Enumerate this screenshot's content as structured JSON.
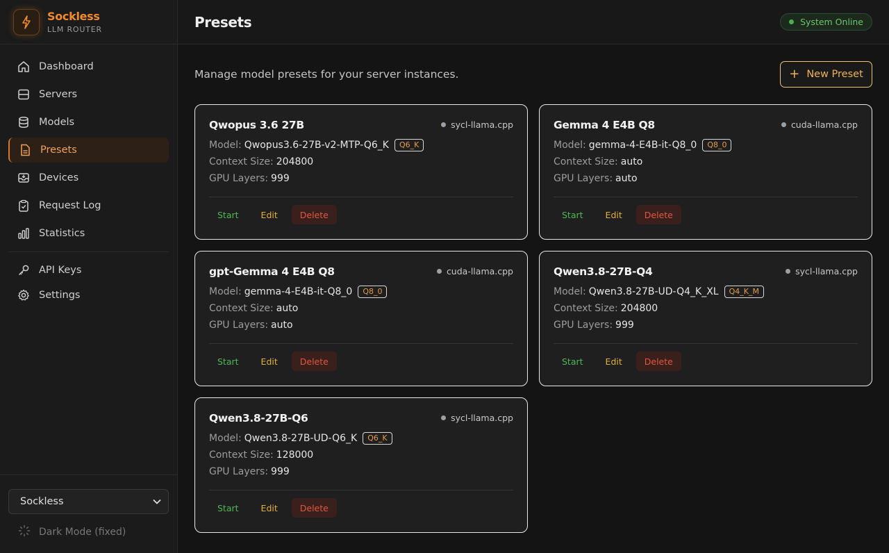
{
  "brand": {
    "name": "Sockless",
    "subtitle": "LLM ROUTER"
  },
  "nav": {
    "items": [
      {
        "label": "Dashboard",
        "icon": "home-icon"
      },
      {
        "label": "Servers",
        "icon": "server-icon"
      },
      {
        "label": "Models",
        "icon": "database-icon"
      },
      {
        "label": "Presets",
        "icon": "document-icon",
        "active": true
      },
      {
        "label": "Devices",
        "icon": "inbox-icon"
      },
      {
        "label": "Request Log",
        "icon": "clipboard-icon"
      },
      {
        "label": "Statistics",
        "icon": "bar-chart-icon"
      }
    ],
    "secondary": [
      {
        "label": "API Keys",
        "icon": "key-icon"
      },
      {
        "label": "Settings",
        "icon": "gear-icon"
      }
    ]
  },
  "workspace": {
    "selected": "Sockless"
  },
  "theme": {
    "label": "Dark Mode (fixed)"
  },
  "header": {
    "title": "Presets",
    "status": "System Online"
  },
  "main": {
    "description": "Manage model presets for your server instances.",
    "new_button": "New Preset",
    "plus_symbol": "+"
  },
  "labels": {
    "model": "Model:",
    "context": "Context Size:",
    "gpu": "GPU Layers:",
    "start": "Start",
    "edit": "Edit",
    "delete": "Delete"
  },
  "presets": [
    {
      "name": "Qwopus 3.6 27B",
      "engine": "sycl-llama.cpp",
      "model": "Qwopus3.6-27B-v2-MTP-Q6_K",
      "quant": "Q6_K",
      "context": "204800",
      "gpu": "999"
    },
    {
      "name": "Gemma 4 E4B Q8",
      "engine": "cuda-llama.cpp",
      "model": "gemma-4-E4B-it-Q8_0",
      "quant": "Q8_0",
      "context": "auto",
      "gpu": "auto"
    },
    {
      "name": "gpt-Gemma 4 E4B Q8",
      "engine": "cuda-llama.cpp",
      "model": "gemma-4-E4B-it-Q8_0",
      "quant": "Q8_0",
      "context": "auto",
      "gpu": "auto"
    },
    {
      "name": "Qwen3.8-27B-Q4",
      "engine": "sycl-llama.cpp",
      "model": "Qwen3.8-27B-UD-Q4_K_XL",
      "quant": "Q4_K_M",
      "context": "204800",
      "gpu": "999"
    },
    {
      "name": "Qwen3.8-27B-Q6",
      "engine": "sycl-llama.cpp",
      "model": "Qwen3.8-27B-UD-Q6_K",
      "quant": "Q6_K",
      "context": "128000",
      "gpu": "999"
    }
  ],
  "colors": {
    "accent": "#f08a2c",
    "online": "#4caf50",
    "start": "#4fb855",
    "edit": "#e2b13c",
    "delete": "#e0573f"
  }
}
